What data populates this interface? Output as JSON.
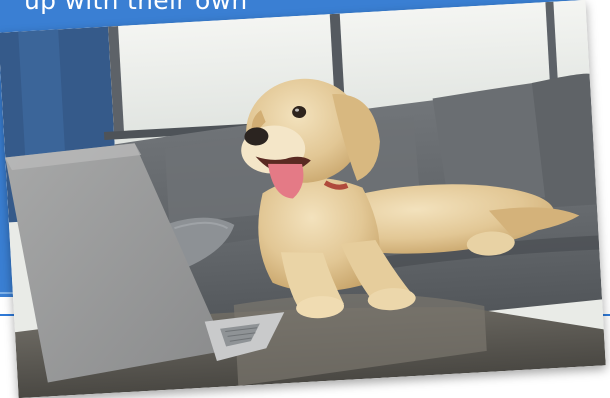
{
  "banner": {
    "caption": "up with their own",
    "color": "#3a7fd3"
  },
  "photo": {
    "subject": "golden-retriever-on-sofa-with-laptop"
  },
  "colors": {
    "rule_light": "#7fb2ea",
    "rule_dark": "#2f7ad8"
  }
}
